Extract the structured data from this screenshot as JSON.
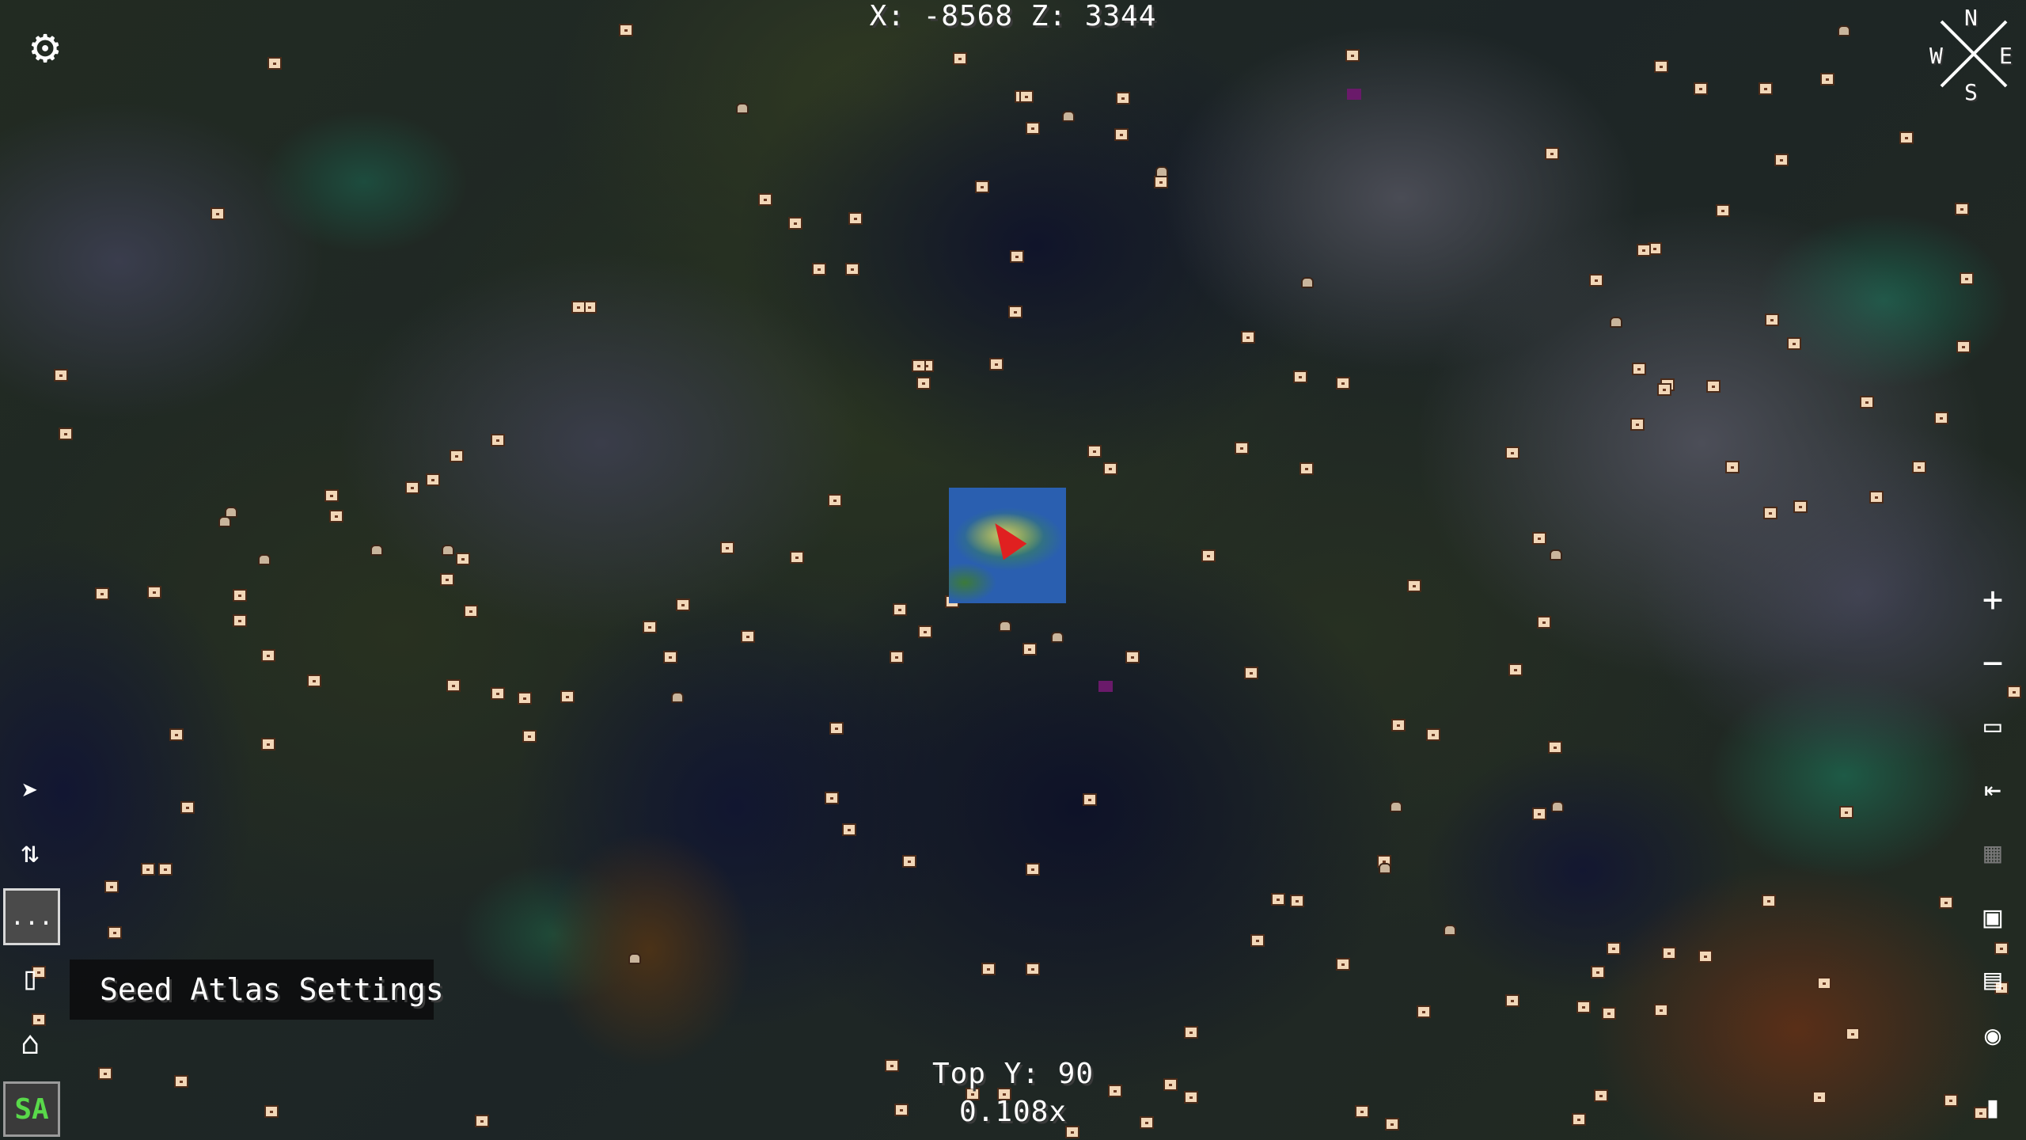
{
  "hud": {
    "coordinates": "X: -8568 Z: 3344",
    "top_y": "Top Y: 90",
    "zoom": "0.108x"
  },
  "compass": {
    "north": "N",
    "east": "E",
    "south": "S",
    "west": "W"
  },
  "tooltip": {
    "text": "Seed Atlas Settings"
  },
  "left_toolbar": {
    "more_label": "...",
    "sa_label": "SA"
  },
  "right_toolbar": {
    "zoom_in": "+",
    "zoom_out": "−"
  },
  "icons": [
    "gear-icon",
    "compass-icon",
    "add-waypoint-icon",
    "swap-arrows-icon",
    "more-button",
    "scroll-icon",
    "home-icon",
    "seed-atlas-button",
    "zoom-in-icon",
    "zoom-out-icon",
    "square-icon",
    "exit-icon",
    "grid-icon",
    "creeper-icon",
    "chest-icon",
    "eye-icon",
    "book-icon"
  ],
  "colors": {
    "hud_text": "#ffffff",
    "sa_text": "#59d94a",
    "player_arrow": "#e02020"
  }
}
